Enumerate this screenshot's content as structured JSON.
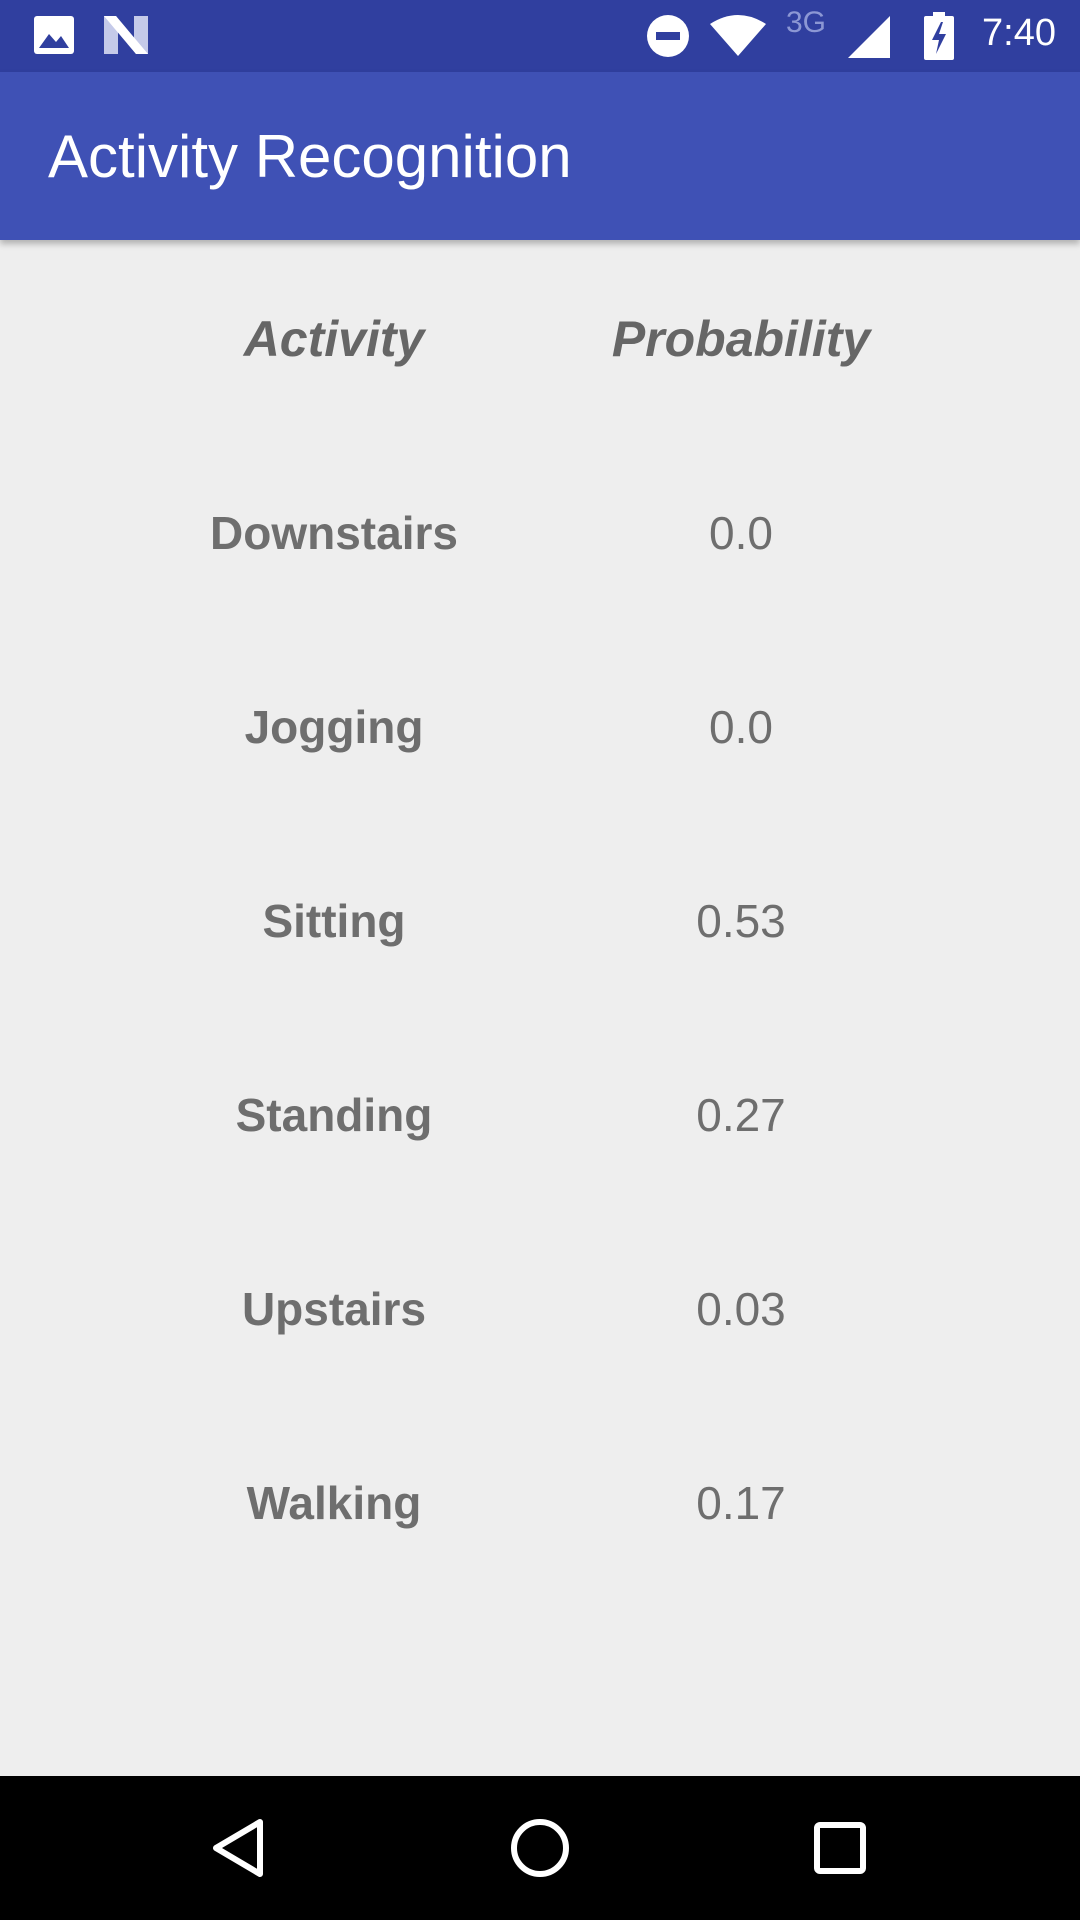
{
  "status_bar": {
    "time": "7:40",
    "network_label": "3G",
    "icons": [
      "image-icon",
      "n-logo-icon",
      "do-not-disturb-icon",
      "wifi-icon",
      "cell-signal-icon",
      "battery-charging-icon"
    ]
  },
  "app_bar": {
    "title": "Activity Recognition"
  },
  "table": {
    "headers": {
      "activity": "Activity",
      "probability": "Probability"
    },
    "rows": [
      {
        "activity": "Downstairs",
        "probability": "0.0"
      },
      {
        "activity": "Jogging",
        "probability": "0.0"
      },
      {
        "activity": "Sitting",
        "probability": "0.53"
      },
      {
        "activity": "Standing",
        "probability": "0.27"
      },
      {
        "activity": "Upstairs",
        "probability": "0.03"
      },
      {
        "activity": "Walking",
        "probability": "0.17"
      }
    ]
  },
  "nav_bar": {
    "buttons": [
      "back-icon",
      "home-icon",
      "recents-icon"
    ]
  },
  "colors": {
    "status_bar": "#303f9f",
    "app_bar": "#3f51b5",
    "background": "#eeeeee",
    "text": "#6e6e6e",
    "nav_bar": "#000000"
  }
}
